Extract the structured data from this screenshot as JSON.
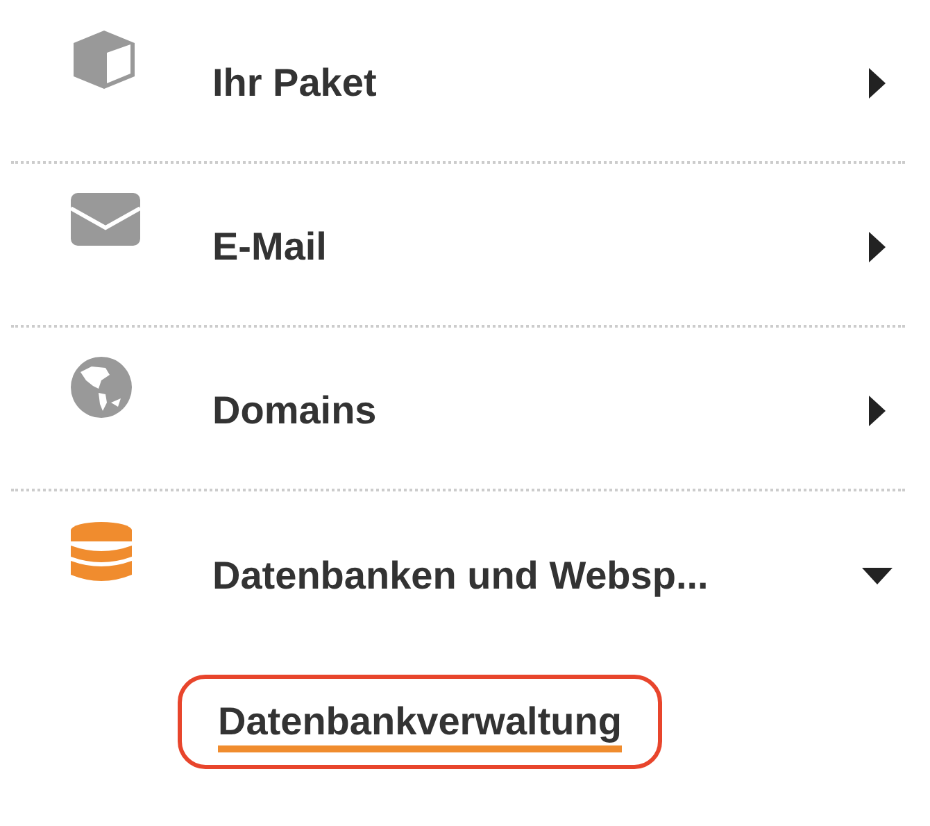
{
  "menu": [
    {
      "kind": "box",
      "label": "Ihr Paket",
      "expanded": false
    },
    {
      "kind": "mail",
      "label": "E-Mail",
      "expanded": false
    },
    {
      "kind": "globe",
      "label": "Domains",
      "expanded": false
    },
    {
      "kind": "database",
      "label": "Datenbanken und Websp...",
      "expanded": true,
      "children": [
        {
          "label": "Datenbankverwaltung",
          "selected": true
        }
      ]
    }
  ]
}
